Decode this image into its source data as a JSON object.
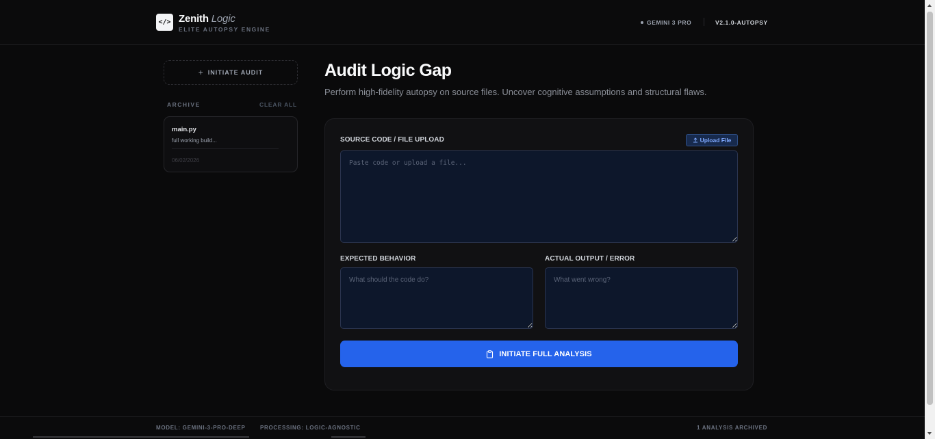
{
  "header": {
    "logo_glyph": "</>",
    "brand_name": "Zenith",
    "brand_accent": "Logic",
    "brand_subtitle": "ELITE AUTOPSY ENGINE",
    "model_badge": "GEMINI 3 PRO",
    "version": "V2.1.0-AUTOPSY"
  },
  "sidebar": {
    "initiate_label": "INITIATE AUDIT",
    "archive_label": "ARCHIVE",
    "clear_all_label": "CLEAR ALL",
    "archive_items": [
      {
        "title": "main.py",
        "description": "full working build...",
        "date": "06/02/2026"
      }
    ]
  },
  "main": {
    "title": "Audit Logic Gap",
    "subtitle": "Perform high-fidelity autopsy on source files. Uncover cognitive assumptions and structural flaws.",
    "source_label": "SOURCE CODE / FILE UPLOAD",
    "upload_label": "Upload File",
    "source_placeholder": "Paste code or upload a file...",
    "expected_label": "EXPECTED BEHAVIOR",
    "expected_placeholder": "What should the code do?",
    "actual_label": "ACTUAL OUTPUT / ERROR",
    "actual_placeholder": "What went wrong?",
    "analyze_label": "INITIATE FULL ANALYSIS"
  },
  "footer": {
    "model": "MODEL: GEMINI-3-PRO-DEEP",
    "processing": "PROCESSING: LOGIC-AGNOSTIC",
    "archived_count": "1 ANALYSIS ARCHIVED"
  },
  "colors": {
    "accent": "#2563eb",
    "background": "#0a0a0b",
    "input_background": "#0d172b"
  },
  "icons": [
    "code-icon",
    "plus-icon",
    "upload-icon",
    "clipboard-icon"
  ]
}
